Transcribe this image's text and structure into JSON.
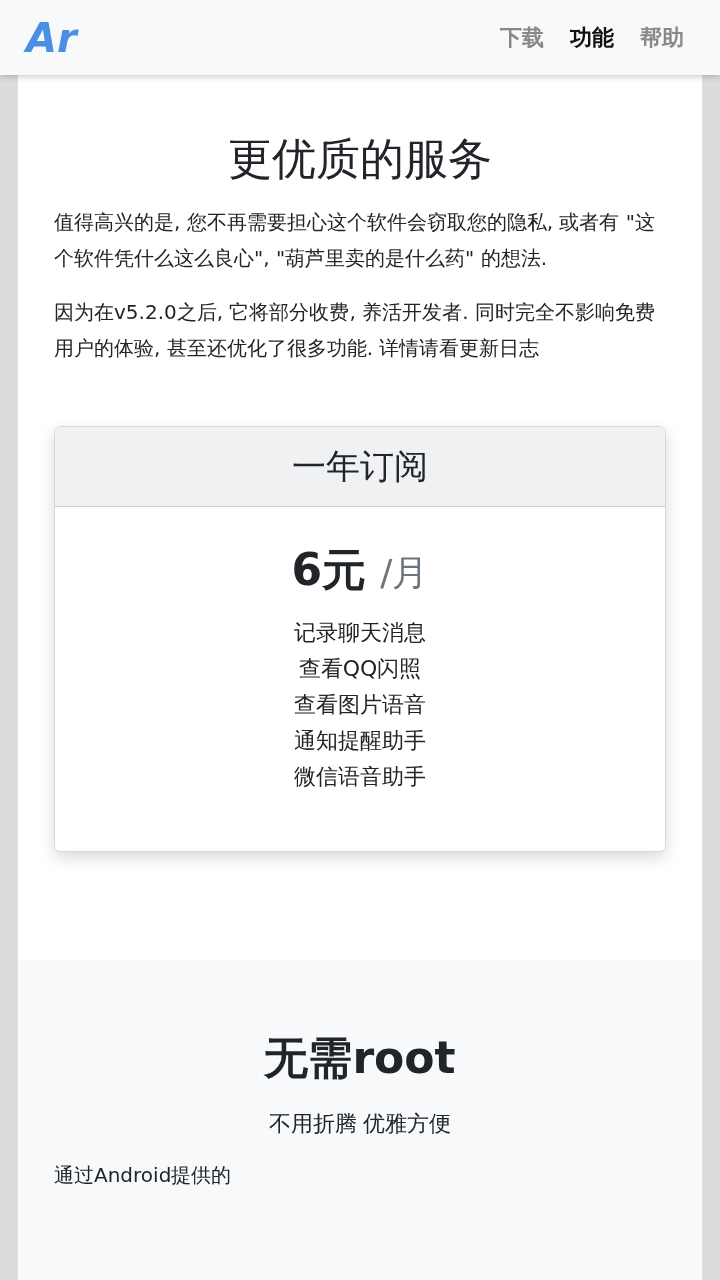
{
  "header": {
    "logo": "Ar",
    "nav": [
      {
        "label": "下载",
        "selected": false
      },
      {
        "label": "功能",
        "selected": true
      },
      {
        "label": "帮助",
        "selected": false
      }
    ]
  },
  "service": {
    "title": "更优质的服务",
    "paragraphs": [
      "值得高兴的是, 您不再需要担心这个软件会窃取您的隐私, 或者有 \"这个软件凭什么这么良心\", \"葫芦里卖的是什么药\" 的想法.",
      "因为在v5.2.0之后, 它将部分收费, 养活开发者. 同时完全不影响免费用户的体验, 甚至还优化了很多功能. 详情请看更新日志"
    ]
  },
  "plan": {
    "title": "一年订阅",
    "price": "6元",
    "unit": "/月",
    "features": [
      "记录聊天消息",
      "查看QQ闪照",
      "查看图片语音",
      "通知提醒助手",
      "微信语音助手"
    ]
  },
  "no_root": {
    "title": "无需root",
    "subtitle": "不用折腾 优雅方便",
    "text": "通过Android提供的"
  }
}
